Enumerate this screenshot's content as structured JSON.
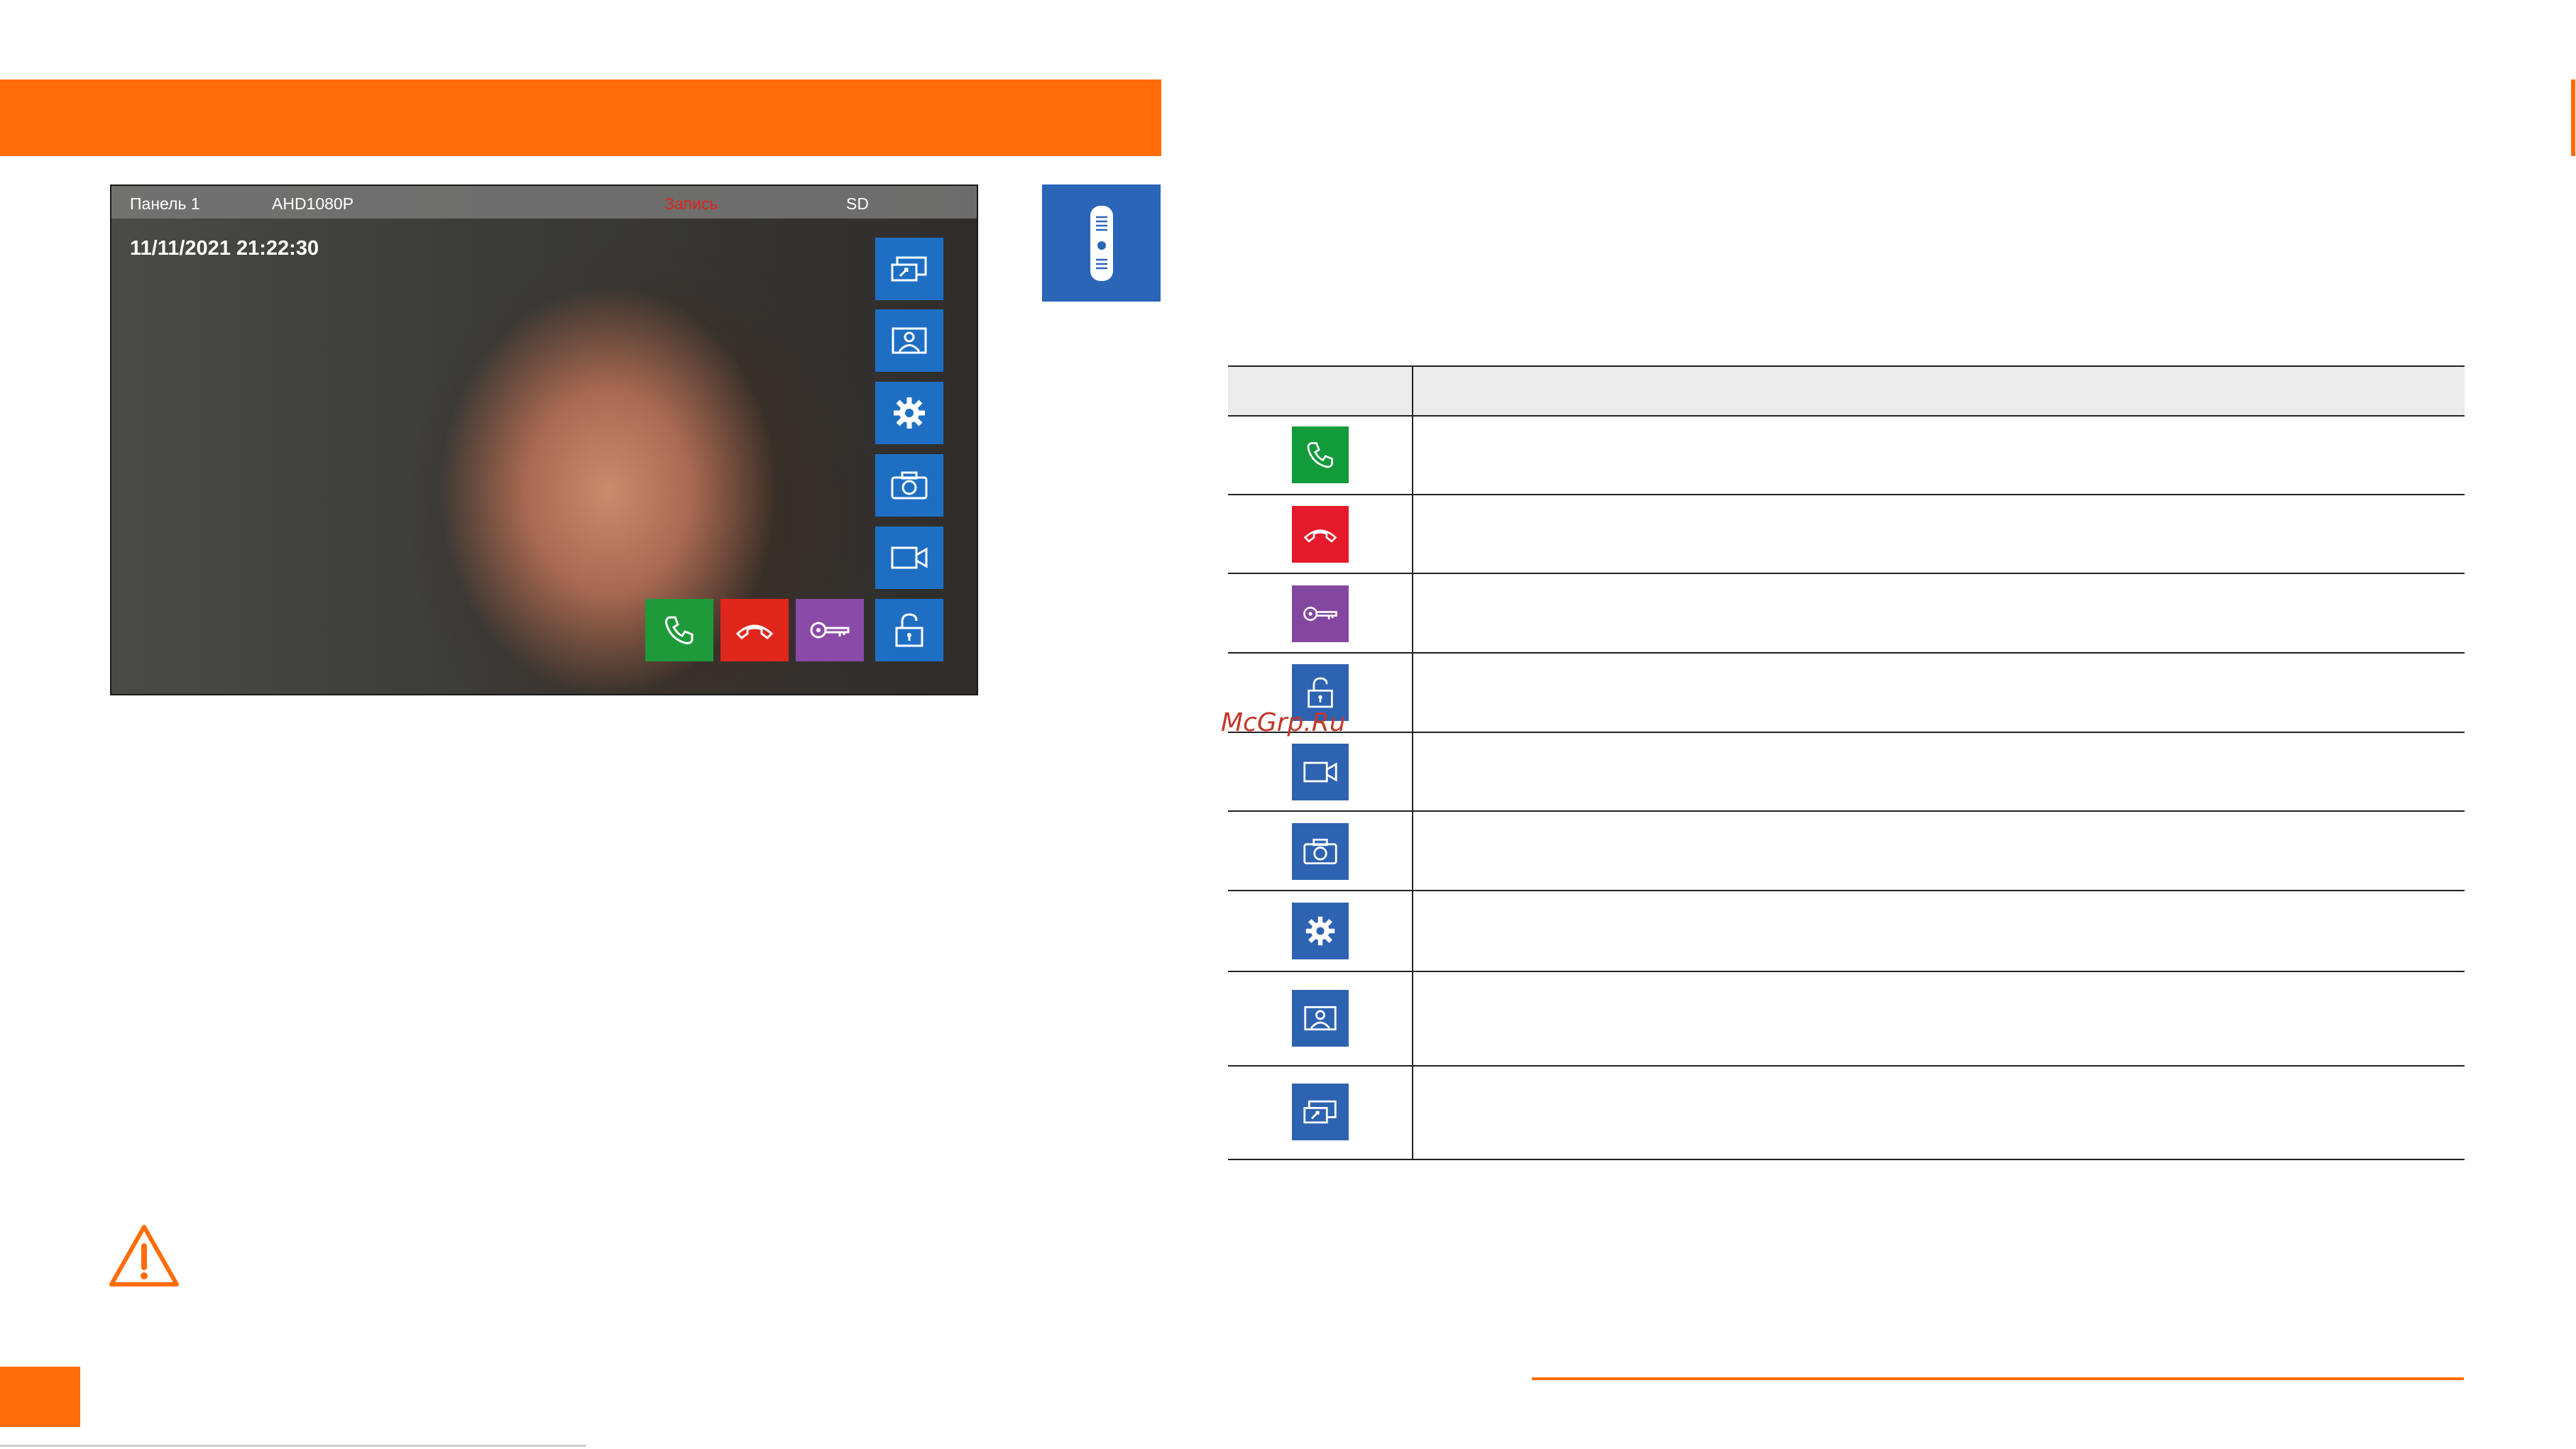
{
  "screen": {
    "status_bar": {
      "panel": "Панель 1",
      "resolution": "AHD1080P",
      "recording": "Запись",
      "storage": "SD"
    },
    "datetime": "11/11/2021 21:22:30",
    "side_buttons": [
      "share-screen-icon",
      "gallery-icon",
      "gear-icon",
      "camera-icon",
      "video-record-icon"
    ],
    "bottom_buttons": [
      "phone-answer-icon",
      "phone-hangup-icon",
      "key-icon",
      "unlock-icon"
    ]
  },
  "camera_tile_icon": "door-panel-icon",
  "legend_table": {
    "header": [
      "",
      ""
    ],
    "rows": [
      {
        "icon": "phone-answer-icon",
        "description": ""
      },
      {
        "icon": "phone-hangup-icon",
        "description": ""
      },
      {
        "icon": "key-icon",
        "description": ""
      },
      {
        "icon": "unlock-icon",
        "description": ""
      },
      {
        "icon": "video-record-icon",
        "description": ""
      },
      {
        "icon": "camera-icon",
        "description": ""
      },
      {
        "icon": "gear-icon",
        "description": ""
      },
      {
        "icon": "gallery-icon",
        "description": ""
      },
      {
        "icon": "share-screen-icon",
        "description": ""
      }
    ]
  },
  "watermark": "McGrp.Ru",
  "colors": {
    "accent_orange": "#ff6c0a",
    "tile_blue": "#1e6fc4",
    "answer_green": "#1e9a3a",
    "hangup_red": "#e0271c",
    "key_purple": "#8a4aa8",
    "recording_red": "#e0241c"
  }
}
